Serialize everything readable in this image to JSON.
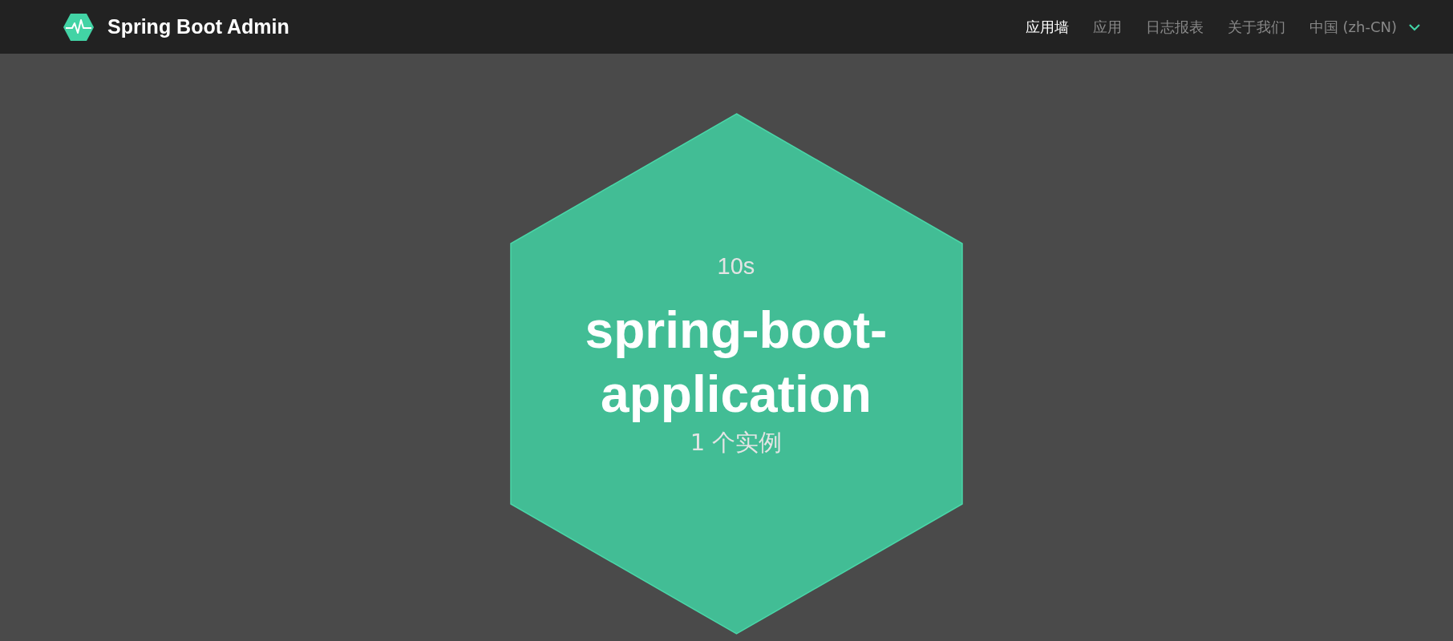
{
  "header": {
    "title": "Spring Boot Admin",
    "nav": [
      {
        "label": "应用墙",
        "selected": true
      },
      {
        "label": "应用",
        "selected": false
      },
      {
        "label": "日志报表",
        "selected": false
      },
      {
        "label": "关于我们",
        "selected": false
      }
    ],
    "language": "中国 (zh-CN)"
  },
  "applications": [
    {
      "time": "10s",
      "name": "spring-boot-application",
      "instances": "1 个实例"
    }
  ]
}
